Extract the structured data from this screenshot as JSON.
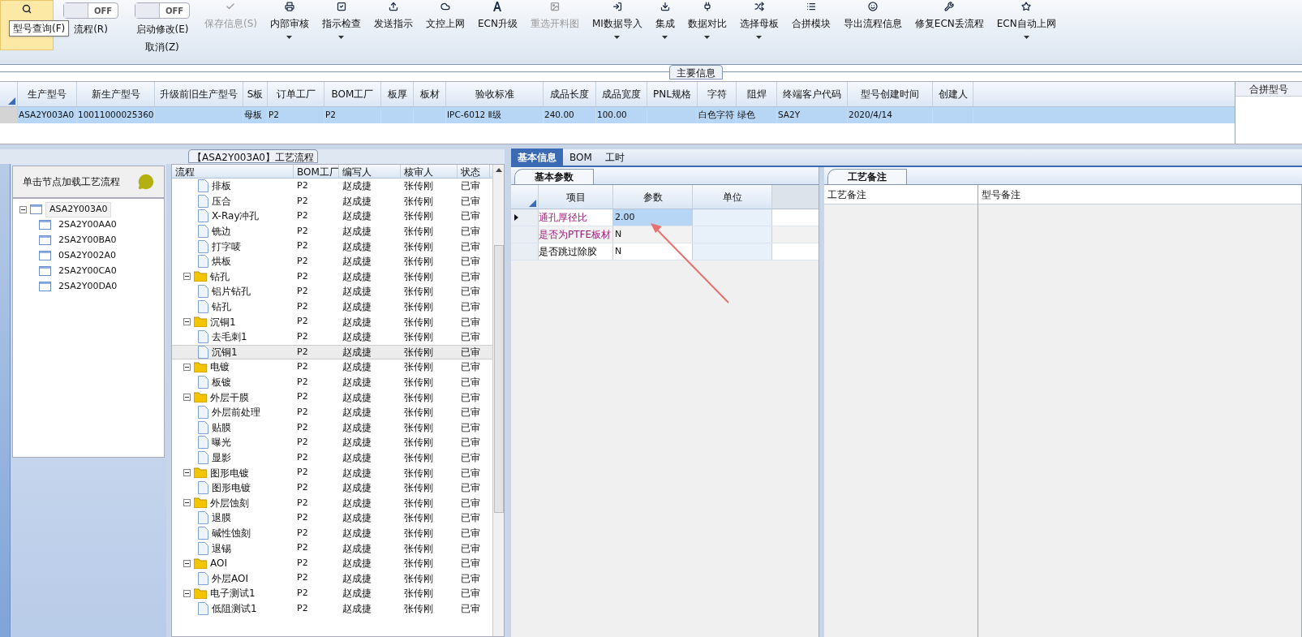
{
  "toolbar": {
    "tooltip": "型号查询(F)",
    "items": [
      {
        "kind": "search"
      },
      {
        "kind": "toggle",
        "switch": "OFF",
        "on": false,
        "labels": [
          "流程(R)"
        ]
      },
      {
        "kind": "toggle",
        "switch": "OFF",
        "on": false,
        "labels": [
          "启动修改(E)",
          "取消(Z)"
        ]
      },
      {
        "kind": "button",
        "label": "保存信息(S)",
        "disabled": true,
        "dropdown": false
      },
      {
        "kind": "button",
        "label": "内部审核",
        "disabled": false,
        "dropdown": true
      },
      {
        "kind": "button",
        "label": "指示检查",
        "disabled": false,
        "dropdown": true
      },
      {
        "kind": "button",
        "label": "发送指示",
        "disabled": false,
        "dropdown": false
      },
      {
        "kind": "button",
        "label": "文控上网",
        "disabled": false,
        "dropdown": false
      },
      {
        "kind": "button",
        "label": "ECN升级",
        "disabled": false,
        "dropdown": false
      },
      {
        "kind": "button",
        "label": "重选开料图",
        "disabled": true,
        "dropdown": false
      },
      {
        "kind": "button",
        "label": "MI数据导入",
        "disabled": false,
        "dropdown": true
      },
      {
        "kind": "button",
        "label": "集成",
        "disabled": false,
        "dropdown": true
      },
      {
        "kind": "button",
        "label": "数据对比",
        "disabled": false,
        "dropdown": true
      },
      {
        "kind": "button",
        "label": "选择母板",
        "disabled": false,
        "dropdown": true
      },
      {
        "kind": "button",
        "label": "合拼模块",
        "disabled": false,
        "dropdown": false
      },
      {
        "kind": "button",
        "label": "导出流程信息",
        "disabled": false,
        "dropdown": false
      },
      {
        "kind": "button",
        "label": "修复ECN丢流程",
        "disabled": false,
        "dropdown": false
      },
      {
        "kind": "button",
        "label": "ECN自动上网",
        "disabled": false,
        "dropdown": true
      }
    ]
  },
  "main_info": {
    "title": "主要信息",
    "columns": [
      "生产型号",
      "新生产型号",
      "升级前旧生产型号",
      "S板",
      "订单工厂",
      "BOM工厂",
      "板厚",
      "板材",
      "验收标准",
      "成品长度",
      "成品宽度",
      "PNL规格",
      "字符",
      "阻焊",
      "终端客户代码",
      "型号创建时间",
      "创建人"
    ],
    "rows": [
      {
        "selected": true,
        "cells": [
          "ASA2Y003A0",
          "10011000025360",
          "",
          "母板",
          "P2",
          "P2",
          "",
          "",
          "IPC-6012 Ⅱ级",
          "240.00",
          "100.00",
          "",
          "白色字符",
          "绿色",
          "SA2Y",
          "2020/4/14",
          ""
        ]
      }
    ],
    "side_column": "合拼型号"
  },
  "model_tree": {
    "hint": "单击节点加载工艺流程",
    "root": {
      "label": "ASA2Y003A0",
      "selected": true,
      "expanded": true,
      "children": [
        {
          "label": "2SA2Y00AA0",
          "selected": false
        },
        {
          "label": "2SA2Y00BA0",
          "selected": false
        },
        {
          "label": "0SA2Y002A0",
          "selected": false
        },
        {
          "label": "2SA2Y00CA0",
          "selected": false
        },
        {
          "label": "2SA2Y00DA0",
          "selected": false
        }
      ]
    }
  },
  "process": {
    "title": "【ASA2Y003A0】工艺流程",
    "columns": [
      "流程",
      "BOM工厂",
      "编写人",
      "核审人",
      "状态"
    ],
    "rows": [
      {
        "kind": "continued",
        "children": [
          {
            "kind": "step",
            "name": "排板",
            "bom": "P2",
            "writer": "赵成捷",
            "reviewer": "张传刚",
            "status": "已审",
            "selected": false
          },
          {
            "kind": "step",
            "name": "压合",
            "bom": "P2",
            "writer": "赵成捷",
            "reviewer": "张传刚",
            "status": "已审",
            "selected": false
          },
          {
            "kind": "step",
            "name": "X-Ray冲孔",
            "bom": "P2",
            "writer": "赵成捷",
            "reviewer": "张传刚",
            "status": "已审",
            "selected": false
          },
          {
            "kind": "step",
            "name": "铣边",
            "bom": "P2",
            "writer": "赵成捷",
            "reviewer": "张传刚",
            "status": "已审",
            "selected": false
          },
          {
            "kind": "step",
            "name": "打字唛",
            "bom": "P2",
            "writer": "赵成捷",
            "reviewer": "张传刚",
            "status": "已审",
            "selected": false
          },
          {
            "kind": "step",
            "name": "烘板",
            "bom": "P2",
            "writer": "赵成捷",
            "reviewer": "张传刚",
            "status": "已审",
            "selected": false
          }
        ]
      },
      {
        "kind": "folder",
        "name": "钻孔",
        "bom": "P2",
        "writer": "赵成捷",
        "reviewer": "张传刚",
        "status": "已审",
        "selected": false,
        "children": [
          {
            "kind": "step",
            "name": "铝片钻孔",
            "bom": "P2",
            "writer": "赵成捷",
            "reviewer": "张传刚",
            "status": "已审",
            "selected": false
          },
          {
            "kind": "step",
            "name": "钻孔",
            "bom": "P2",
            "writer": "赵成捷",
            "reviewer": "张传刚",
            "status": "已审",
            "selected": false
          }
        ]
      },
      {
        "kind": "folder",
        "name": "沉铜1",
        "bom": "P2",
        "writer": "赵成捷",
        "reviewer": "张传刚",
        "status": "已审",
        "selected": false,
        "children": [
          {
            "kind": "step",
            "name": "去毛刺1",
            "bom": "P2",
            "writer": "赵成捷",
            "reviewer": "张传刚",
            "status": "已审",
            "selected": false
          },
          {
            "kind": "step",
            "name": "沉铜1",
            "bom": "P2",
            "writer": "赵成捷",
            "reviewer": "张传刚",
            "status": "已审",
            "selected": true
          }
        ]
      },
      {
        "kind": "folder",
        "name": "电镀",
        "bom": "P2",
        "writer": "赵成捷",
        "reviewer": "张传刚",
        "status": "已审",
        "selected": false,
        "children": [
          {
            "kind": "step",
            "name": "板镀",
            "bom": "P2",
            "writer": "赵成捷",
            "reviewer": "张传刚",
            "status": "已审",
            "selected": false
          }
        ]
      },
      {
        "kind": "folder",
        "name": "外层干膜",
        "bom": "P2",
        "writer": "赵成捷",
        "reviewer": "张传刚",
        "status": "已审",
        "selected": false,
        "children": [
          {
            "kind": "step",
            "name": "外层前处理",
            "bom": "P2",
            "writer": "赵成捷",
            "reviewer": "张传刚",
            "status": "已审",
            "selected": false
          },
          {
            "kind": "step",
            "name": "贴膜",
            "bom": "P2",
            "writer": "赵成捷",
            "reviewer": "张传刚",
            "status": "已审",
            "selected": false
          },
          {
            "kind": "step",
            "name": "曝光",
            "bom": "P2",
            "writer": "赵成捷",
            "reviewer": "张传刚",
            "status": "已审",
            "selected": false
          },
          {
            "kind": "step",
            "name": "显影",
            "bom": "P2",
            "writer": "赵成捷",
            "reviewer": "张传刚",
            "status": "已审",
            "selected": false
          }
        ]
      },
      {
        "kind": "folder",
        "name": "图形电镀",
        "bom": "P2",
        "writer": "赵成捷",
        "reviewer": "张传刚",
        "status": "已审",
        "selected": false,
        "children": [
          {
            "kind": "step",
            "name": "图形电镀",
            "bom": "P2",
            "writer": "赵成捷",
            "reviewer": "张传刚",
            "status": "已审",
            "selected": false
          }
        ]
      },
      {
        "kind": "folder",
        "name": "外层蚀刻",
        "bom": "P2",
        "writer": "赵成捷",
        "reviewer": "张传刚",
        "status": "已审",
        "selected": false,
        "children": [
          {
            "kind": "step",
            "name": "退膜",
            "bom": "P2",
            "writer": "赵成捷",
            "reviewer": "张传刚",
            "status": "已审",
            "selected": false
          },
          {
            "kind": "step",
            "name": "碱性蚀刻",
            "bom": "P2",
            "writer": "赵成捷",
            "reviewer": "张传刚",
            "status": "已审",
            "selected": false
          },
          {
            "kind": "step",
            "name": "退锡",
            "bom": "P2",
            "writer": "赵成捷",
            "reviewer": "张传刚",
            "status": "已审",
            "selected": false
          }
        ]
      },
      {
        "kind": "folder",
        "name": "AOI",
        "bom": "P2",
        "writer": "赵成捷",
        "reviewer": "张传刚",
        "status": "已审",
        "selected": false,
        "children": [
          {
            "kind": "step",
            "name": "外层AOI",
            "bom": "P2",
            "writer": "赵成捷",
            "reviewer": "张传刚",
            "status": "已审",
            "selected": false
          }
        ]
      },
      {
        "kind": "folder",
        "name": "电子测试1",
        "bom": "P2",
        "writer": "赵成捷",
        "reviewer": "张传刚",
        "status": "已审",
        "selected": false,
        "children": [
          {
            "kind": "step",
            "name": "低阻测试1",
            "bom": "P2",
            "writer": "赵成捷",
            "reviewer": "张传刚",
            "status": "已审",
            "selected": false
          }
        ]
      }
    ]
  },
  "detail_tabs": [
    {
      "label": "基本信息",
      "selected": true
    },
    {
      "label": "BOM",
      "selected": false
    },
    {
      "label": "工时",
      "selected": false
    }
  ],
  "params": {
    "tab": "基本参数",
    "columns": [
      "项目",
      "参数",
      "单位"
    ],
    "rows": [
      {
        "item": "通孔厚径比",
        "value": "2.00",
        "required": true,
        "selected": true
      },
      {
        "item": "是否为PTFE板材",
        "value": "N",
        "required": true,
        "selected": false
      },
      {
        "item": "是否跳过除胶",
        "value": "N",
        "required": false,
        "selected": false
      }
    ]
  },
  "notes": {
    "tab": "工艺备注",
    "columns": [
      "工艺备注",
      "型号备注"
    ]
  }
}
